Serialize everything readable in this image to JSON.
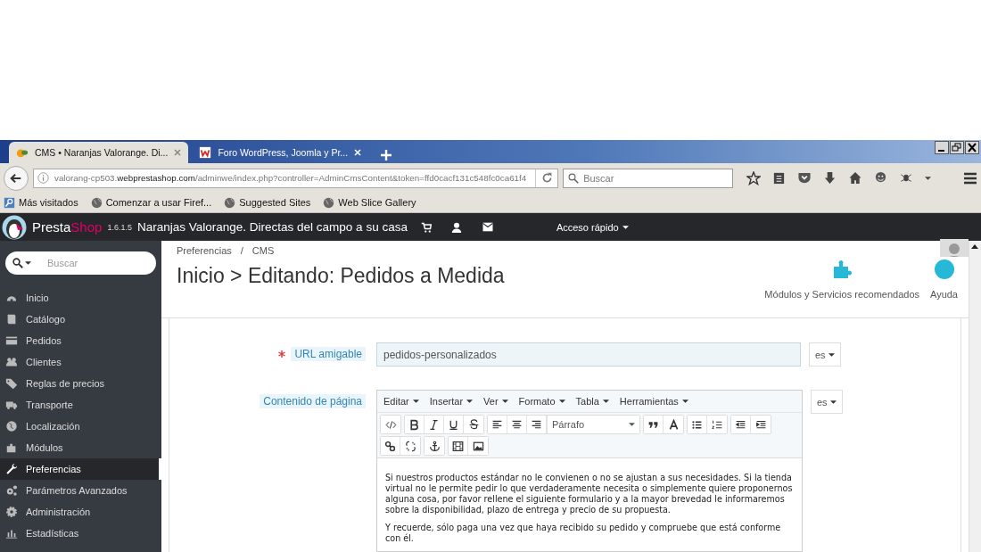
{
  "browser": {
    "tabs": [
      {
        "title": "CMS • Naranjas Valorange. Di...",
        "selected": true
      },
      {
        "title": "Foro WordPress, Joomla y Pr...",
        "selected": false
      }
    ],
    "url": {
      "subdomain": "valorang-cp503.",
      "domain": "webprestashop.com",
      "path": "/adminwe/index.php?controller=AdminCmsContent&token=ffd0cacf131c548fc0ca61f4"
    },
    "search_placeholder": "Buscar",
    "bookmarks": [
      "Más visitados",
      "Comenzar a usar Firef...",
      "Suggested Sites",
      "Web Slice Gallery"
    ]
  },
  "header": {
    "logo_first": "Presta",
    "logo_second": "Shop",
    "version": "1.6.1.5",
    "shop_name": "Naranjas Valorange. Directas del campo a su casa",
    "quick_access": "Acceso rápido"
  },
  "sidebar": {
    "search_placeholder": "Buscar",
    "items": [
      {
        "label": "Inicio",
        "selected": false
      },
      {
        "label": "Catálogo",
        "selected": false
      },
      {
        "label": "Pedidos",
        "selected": false
      },
      {
        "label": "Clientes",
        "selected": false
      },
      {
        "label": "Reglas de precios",
        "selected": false
      },
      {
        "label": "Transporte",
        "selected": false
      },
      {
        "label": "Localización",
        "selected": false
      },
      {
        "label": "Módulos",
        "selected": false
      },
      {
        "label": "Preferencias",
        "selected": true
      },
      {
        "label": "Parámetros Avanzados",
        "selected": false
      },
      {
        "label": "Administración",
        "selected": false
      },
      {
        "label": "Estadísticas",
        "selected": false
      }
    ]
  },
  "page": {
    "breadcrumb": [
      "Preferencias",
      "CMS"
    ],
    "breadcrumb_separator": "/",
    "title": "Inicio > Editando: Pedidos a Medida",
    "toolbar": [
      "Módulos y Servicios recomendados",
      "Ayuda"
    ]
  },
  "form": {
    "url_field": {
      "label": "URL amigable",
      "required": true,
      "value": "pedidos-personalizados",
      "language": "es"
    },
    "content_field": {
      "label": "Contenido de página",
      "language": "es",
      "menus": [
        "Editar",
        "Insertar",
        "Ver",
        "Formato",
        "Tabla",
        "Herramientas"
      ],
      "block_format": "Párrafo",
      "paragraphs": [
        "Si nuestros productos estándar no le convienen o no se ajustan a sus necesidades. Si la tienda virtual no le permite pedir lo que verdaderamente necesita o simplemente quiere proponernos alguna cosa, por favor rellene el siguiente formulario y a la mayor brevedad le informaremos sobre la disponibilidad, plazo de entrega y precio de su propuesta.",
        "Y recuerde, sólo paga una vez que haya recibido su pedido y compruebe que está conforme con él."
      ]
    }
  }
}
